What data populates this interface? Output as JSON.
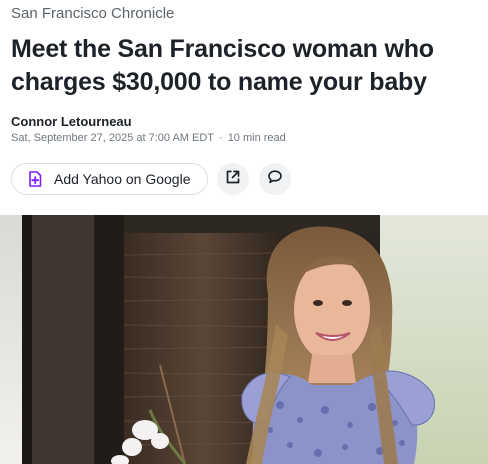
{
  "publisher": "San Francisco Chronicle",
  "headline": "Meet the San Francisco woman who charges $30,000 to name your baby",
  "author": "Connor Letourneau",
  "date": "Sat, September 27, 2025 at 7:00 AM EDT",
  "separator": "·",
  "read_time": "10 min read",
  "actions": {
    "add_google_label": "Add Yahoo on Google",
    "add_google_icon": "plus-document-icon",
    "share_icon": "external-link-icon",
    "comment_icon": "comment-bubble-icon"
  },
  "colors": {
    "accent_purple": "#7e1fff",
    "text_dark": "#1d2228",
    "text_muted": "#6e7780"
  },
  "image": {
    "subject": "smiling woman with long hair near a window with orchids"
  }
}
